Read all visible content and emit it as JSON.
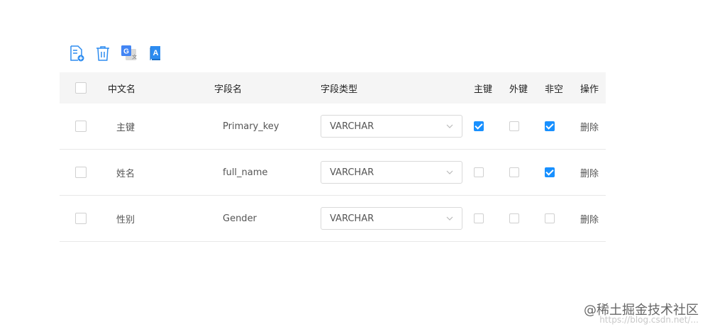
{
  "toolbar": {
    "icons": [
      "add-file-icon",
      "trash-icon",
      "translate-icon",
      "book-icon"
    ]
  },
  "table": {
    "headers": {
      "chinese_name": "中文名",
      "field_name": "字段名",
      "field_type": "字段类型",
      "primary_key": "主键",
      "foreign_key": "外键",
      "not_null": "非空",
      "action": "操作"
    },
    "rows": [
      {
        "chinese_name": "主键",
        "field_name": "Primary_key",
        "field_type": "VARCHAR",
        "primary_key": true,
        "foreign_key": false,
        "not_null": true,
        "action": "删除"
      },
      {
        "chinese_name": "姓名",
        "field_name": "full_name",
        "field_type": "VARCHAR",
        "primary_key": false,
        "foreign_key": false,
        "not_null": true,
        "action": "删除"
      },
      {
        "chinese_name": "性别",
        "field_name": "Gender",
        "field_type": "VARCHAR",
        "primary_key": false,
        "foreign_key": false,
        "not_null": false,
        "action": "删除"
      }
    ]
  },
  "colors": {
    "accent": "#1890ff",
    "header_bg": "#f5f5f5",
    "border": "#e8e8e8"
  },
  "watermark": {
    "brand": "@稀土掘金技术社区",
    "url": "https://blog.csdn.net/..."
  }
}
